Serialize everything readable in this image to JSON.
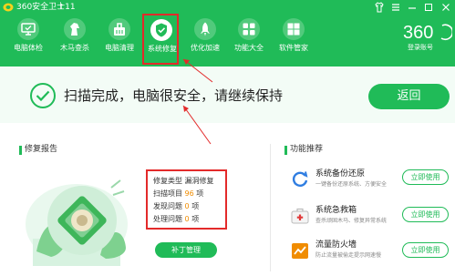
{
  "app": {
    "title": "360安全卫士11"
  },
  "nav": [
    {
      "label": "电脑体检",
      "icon": "monitor-check-icon"
    },
    {
      "label": "木马查杀",
      "icon": "horse-icon"
    },
    {
      "label": "电脑清理",
      "icon": "broom-icon"
    },
    {
      "label": "系统修复",
      "icon": "shield-icon",
      "active": true
    },
    {
      "label": "优化加速",
      "icon": "rocket-icon"
    },
    {
      "label": "功能大全",
      "icon": "grid-icon"
    },
    {
      "label": "软件管家",
      "icon": "software-box-icon"
    }
  ],
  "brand": {
    "logo_text": "360",
    "login": "登录账号"
  },
  "status": {
    "message": "扫描完成，电脑很安全，请继续保持",
    "back_label": "返回"
  },
  "report": {
    "title": "修复报告",
    "header": "修复类型  漏洞修复",
    "rows": [
      {
        "label": "扫描项目",
        "value": "96",
        "unit": "项"
      },
      {
        "label": "发现问题",
        "value": "0",
        "unit": "项"
      },
      {
        "label": "处理问题",
        "value": "0",
        "unit": "项"
      }
    ],
    "patch_button": "补丁管理"
  },
  "features": {
    "title": "功能推荐",
    "items": [
      {
        "name": "系统备份还原",
        "desc": "一键备份还原系统、方便安全",
        "button": "立即使用",
        "icon": "backup-icon"
      },
      {
        "name": "系统急救箱",
        "desc": "查杀顽固木马、修复异常系统",
        "button": "立即使用",
        "icon": "first-aid-icon"
      },
      {
        "name": "流量防火墙",
        "desc": "防止流量被偷走提示网速慢",
        "button": "立即使用",
        "icon": "firewall-icon"
      }
    ]
  },
  "colors": {
    "brand_green": "#20bb58",
    "highlight_red": "#e32a2a",
    "number_orange": "#f08c00"
  }
}
